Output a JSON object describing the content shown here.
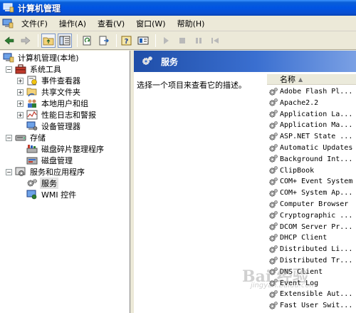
{
  "window": {
    "title": "计算机管理"
  },
  "menu": {
    "items": [
      "文件(F)",
      "操作(A)",
      "查看(V)",
      "窗口(W)",
      "帮助(H)"
    ]
  },
  "toolbar": {
    "buttons": [
      "back-arrow-icon",
      "forward-arrow-icon",
      "up-folder-icon",
      "show-tree-icon",
      "refresh-icon",
      "export-icon",
      "help-icon",
      "properties-icon",
      "play-icon",
      "stop-icon",
      "pause-icon",
      "restart-icon"
    ]
  },
  "tree": {
    "root": "计算机管理(本地)",
    "system_tools": "系统工具",
    "event_viewer": "事件查看器",
    "shared_folders": "共享文件夹",
    "local_users": "本地用户和组",
    "perf_logs": "性能日志和警报",
    "device_manager": "设备管理器",
    "storage": "存储",
    "defrag": "磁盘碎片整理程序",
    "disk_mgmt": "磁盘管理",
    "services_apps": "服务和应用程序",
    "services": "服务",
    "wmi": "WMI 控件"
  },
  "right": {
    "header_title": "服务",
    "description": "选择一个项目来查看它的描述。",
    "column_name": "名称",
    "services": [
      "Adobe Flash Pl...",
      "Apache2.2",
      "Application La...",
      "Application Ma...",
      "ASP.NET State ...",
      "Automatic Updates",
      "Background Int...",
      "ClipBook",
      "COM+ Event System",
      "COM+ System Ap...",
      "Computer Browser",
      "Cryptographic ...",
      "DCOM Server Pr...",
      "DHCP Client",
      "Distributed Li...",
      "Distributed Tr...",
      "DNS Client",
      "Event Log",
      "Extensible Aut...",
      "Fast User Swit..."
    ]
  },
  "watermark": {
    "text": "Bai 经验",
    "sub": "jingyan.baidu.com"
  },
  "colors": {
    "titlebar": "#0054e3",
    "header_gradient_start": "#1f4ea8",
    "chrome": "#ece9d8"
  }
}
